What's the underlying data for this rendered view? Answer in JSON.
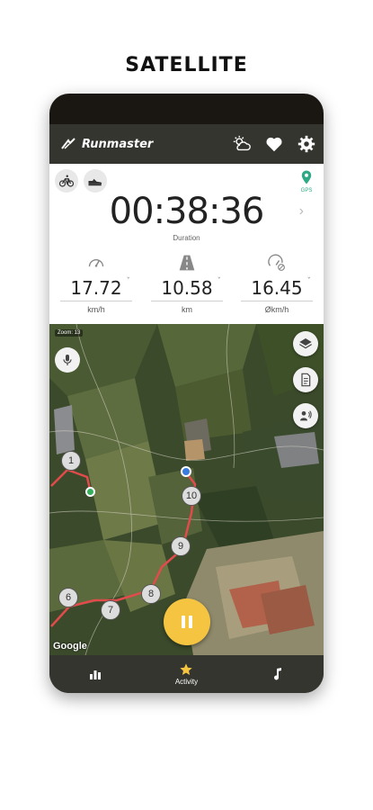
{
  "caption": "SATELLITE",
  "app": {
    "name": "Runmaster"
  },
  "stats": {
    "duration": "00:38:36",
    "duration_label": "Duration",
    "gps_label": "GPS",
    "metrics": [
      {
        "icon": "speedometer-icon",
        "value": "17.72",
        "unit": "km/h"
      },
      {
        "icon": "road-icon",
        "value": "10.58",
        "unit": "km"
      },
      {
        "icon": "average-speed-icon",
        "value": "16.45",
        "unit": "Økm/h"
      }
    ]
  },
  "map": {
    "zoom_label": "Zoom: 13",
    "attribution": "Google",
    "km_markers": [
      "1",
      "10",
      "9",
      "8",
      "7",
      "6"
    ]
  },
  "nav": {
    "activity_label": "Activity"
  },
  "colors": {
    "appbar": "#34352f",
    "accent_yellow": "#f5c542",
    "gps_green": "#2fa886",
    "route_red": "#e04b4b",
    "start_green": "#35b05a",
    "current_blue": "#3a7be0"
  }
}
